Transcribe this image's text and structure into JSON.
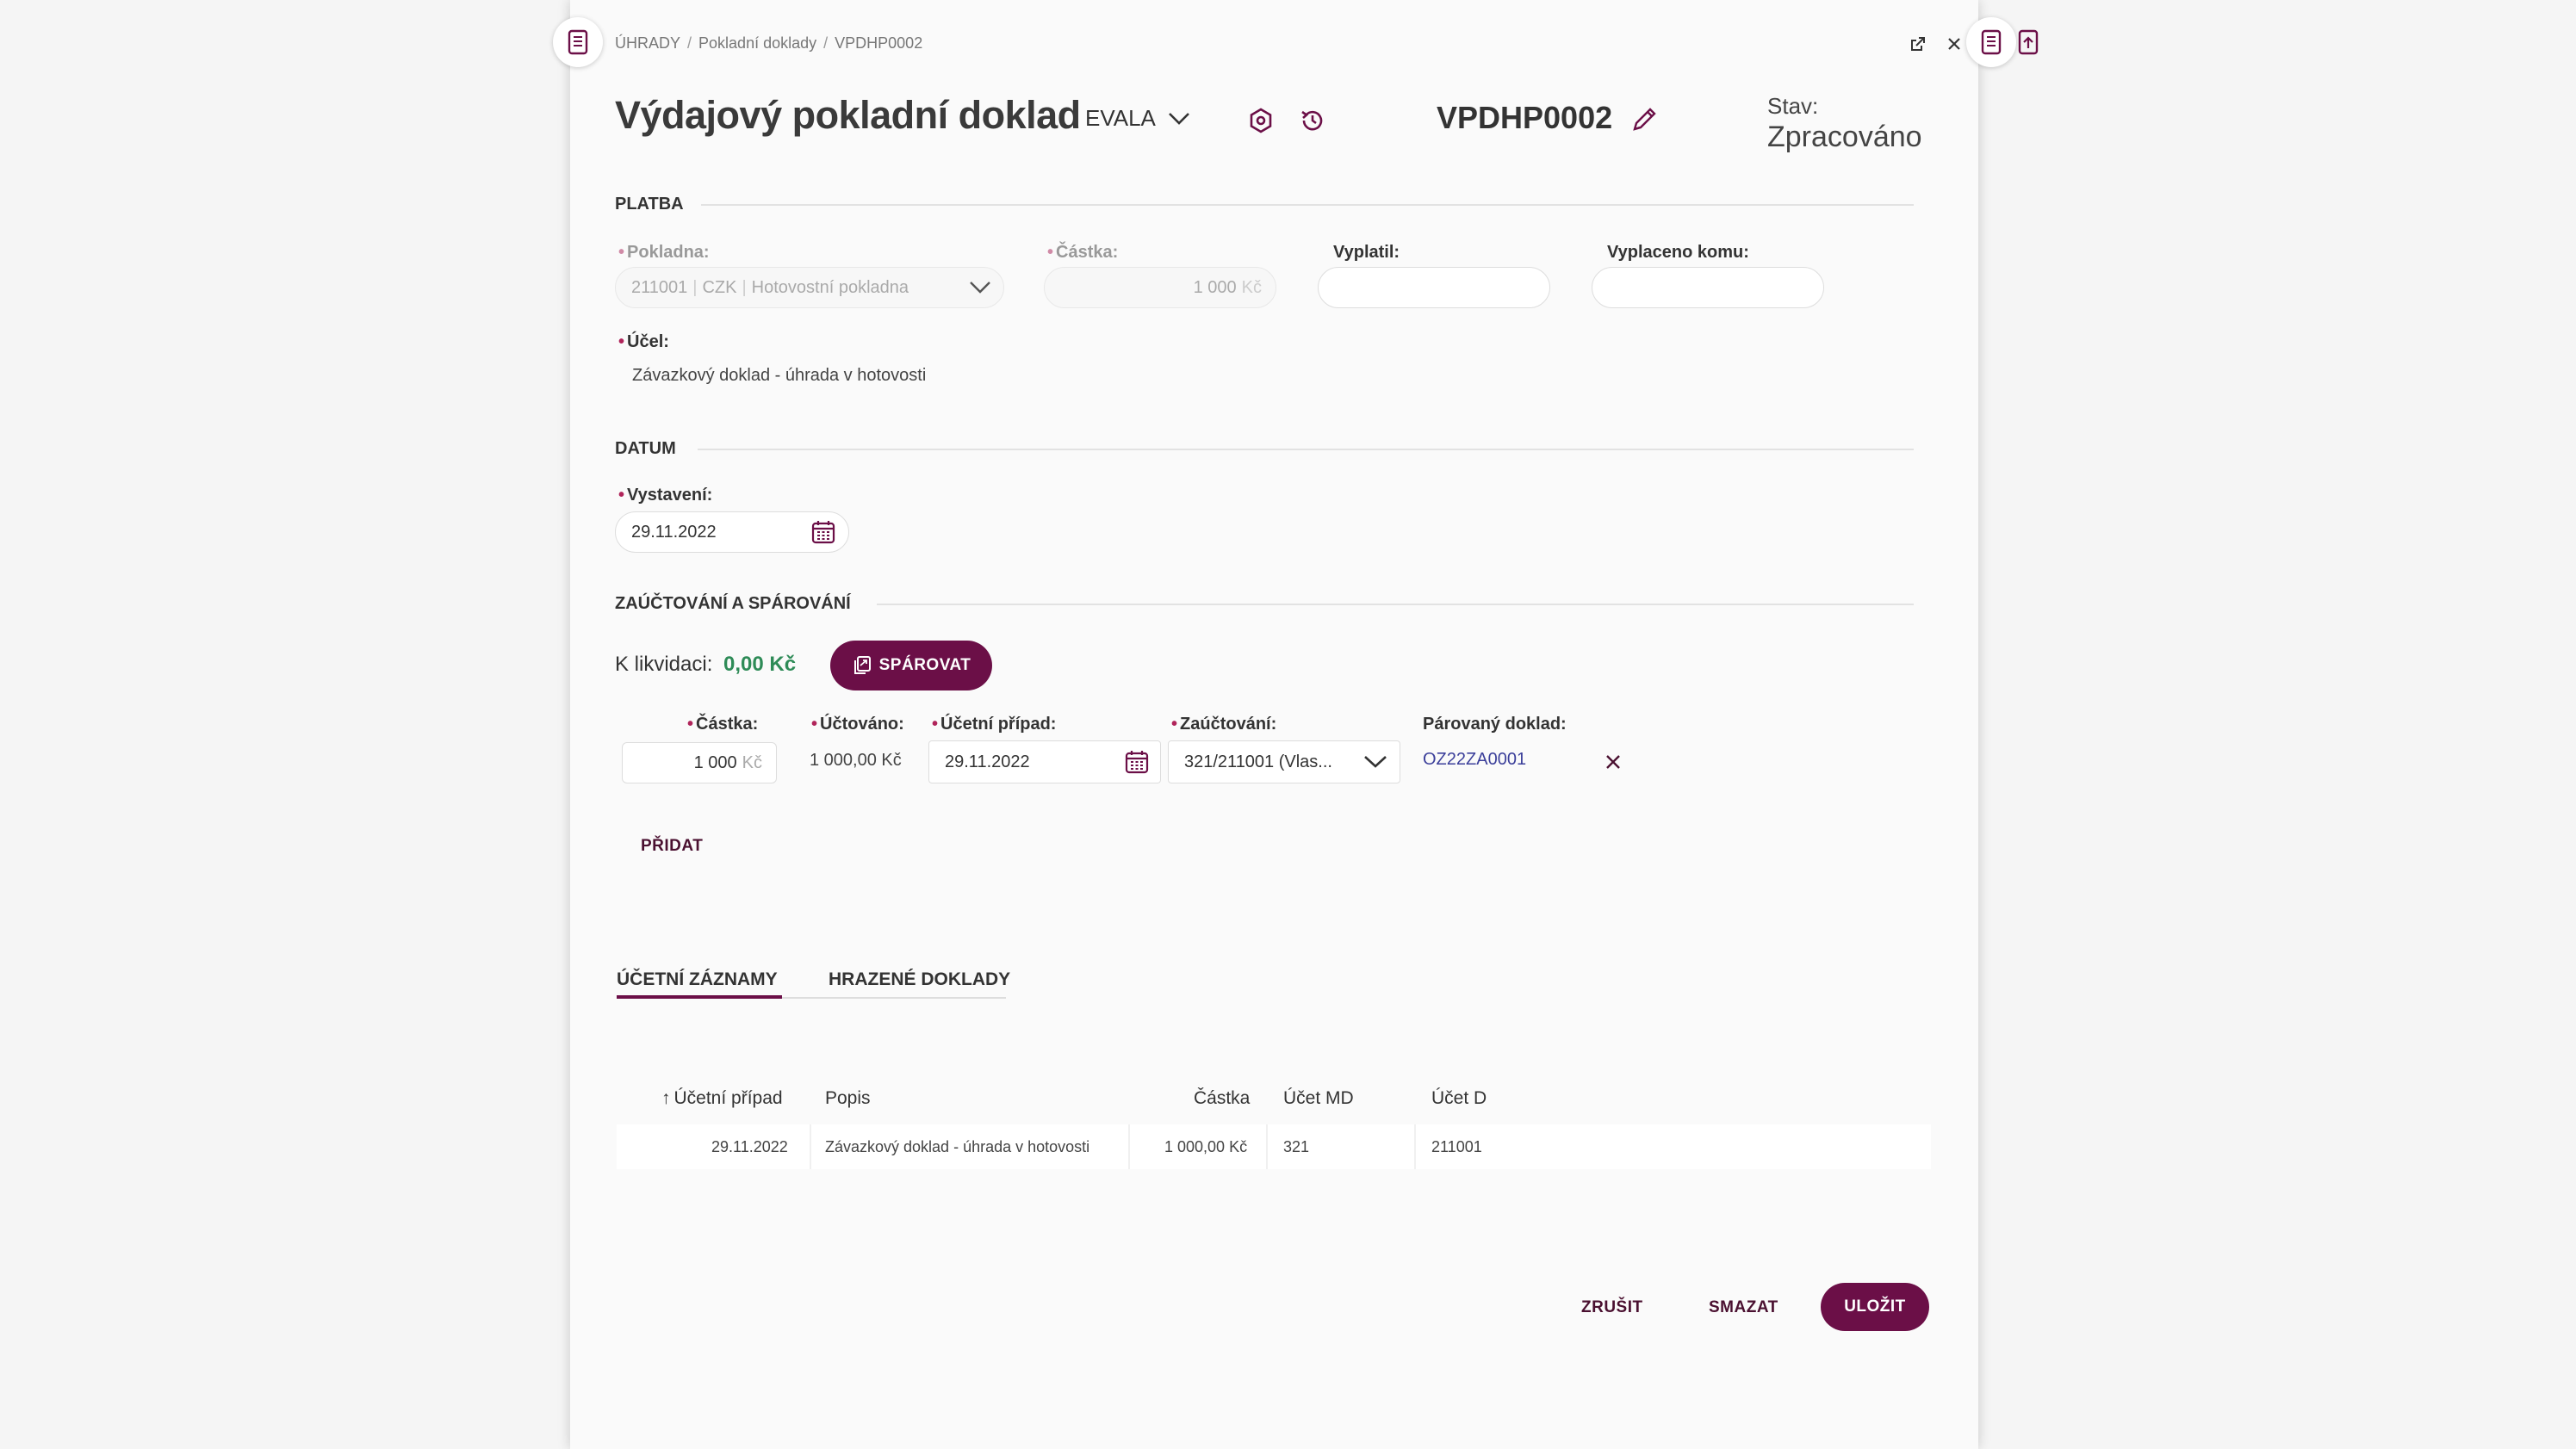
{
  "breadcrumb": [
    "ÚHRADY",
    "Pokladní doklady",
    "VPDHP0002"
  ],
  "header": {
    "title": "Výdajový pokladní doklad",
    "tenant": "EVALA",
    "doc_number": "VPDHP0002",
    "state_label": "Stav:",
    "state_value": "Zpracováno"
  },
  "platba": {
    "section": "PLATBA",
    "pokladna_label": "Pokladna:",
    "pokladna_code": "211001",
    "pokladna_currency": "CZK",
    "pokladna_name": "Hotovostní pokladna",
    "castka_label": "Částka:",
    "castka_value": "1 000",
    "castka_unit": "Kč",
    "vyplatil_label": "Vyplatil:",
    "vyplatil_value": "",
    "vyplaceno_label": "Vyplaceno komu:",
    "vyplaceno_value": "",
    "ucel_label": "Účel:",
    "ucel_value": "Závazkový doklad - úhrada v hotovosti"
  },
  "datum": {
    "section": "DATUM",
    "vystaveni_label": "Vystavení:",
    "vystaveni_value": "29.11.2022"
  },
  "zauctovani": {
    "section": "ZAÚČTOVÁNÍ A SPÁROVÁNÍ",
    "k_likvidaci_label": "K likvidaci:",
    "k_likvidaci_value": "0,00 Kč",
    "sparovat_label": "SPÁROVAT",
    "castka_label": "Částka:",
    "castka_value": "1 000",
    "castka_unit": "Kč",
    "uctovano_label": "Účtováno:",
    "uctovano_value": "1 000,00 Kč",
    "ucetni_pripad_label": "Účetní případ:",
    "ucetni_pripad_value": "29.11.2022",
    "zauctovani_label": "Zaúčtování:",
    "zauctovani_value": "321/211001 (Vlas...",
    "parovany_label": "Párovaný doklad:",
    "parovany_value": "OZ22ZA0001",
    "pridat_label": "PŘIDAT"
  },
  "tabs": [
    "ÚČETNÍ ZÁZNAMY",
    "HRAZENÉ DOKLADY"
  ],
  "table": {
    "headers": [
      "Účetní případ",
      "Popis",
      "Částka",
      "Účet MD",
      "Účet D"
    ],
    "rows": [
      [
        "29.11.2022",
        "Závazkový doklad - úhrada v hotovosti",
        "1 000,00 Kč",
        "321",
        "211001"
      ]
    ]
  },
  "footer": {
    "cancel_label": "ZRUŠIT",
    "delete_label": "SMAZAT",
    "save_label": "ULOŽIT"
  },
  "colors": {
    "brand": "#6b0f47",
    "positive": "#2e8b57",
    "link": "#3b3f9a",
    "required": "#b0245a"
  }
}
